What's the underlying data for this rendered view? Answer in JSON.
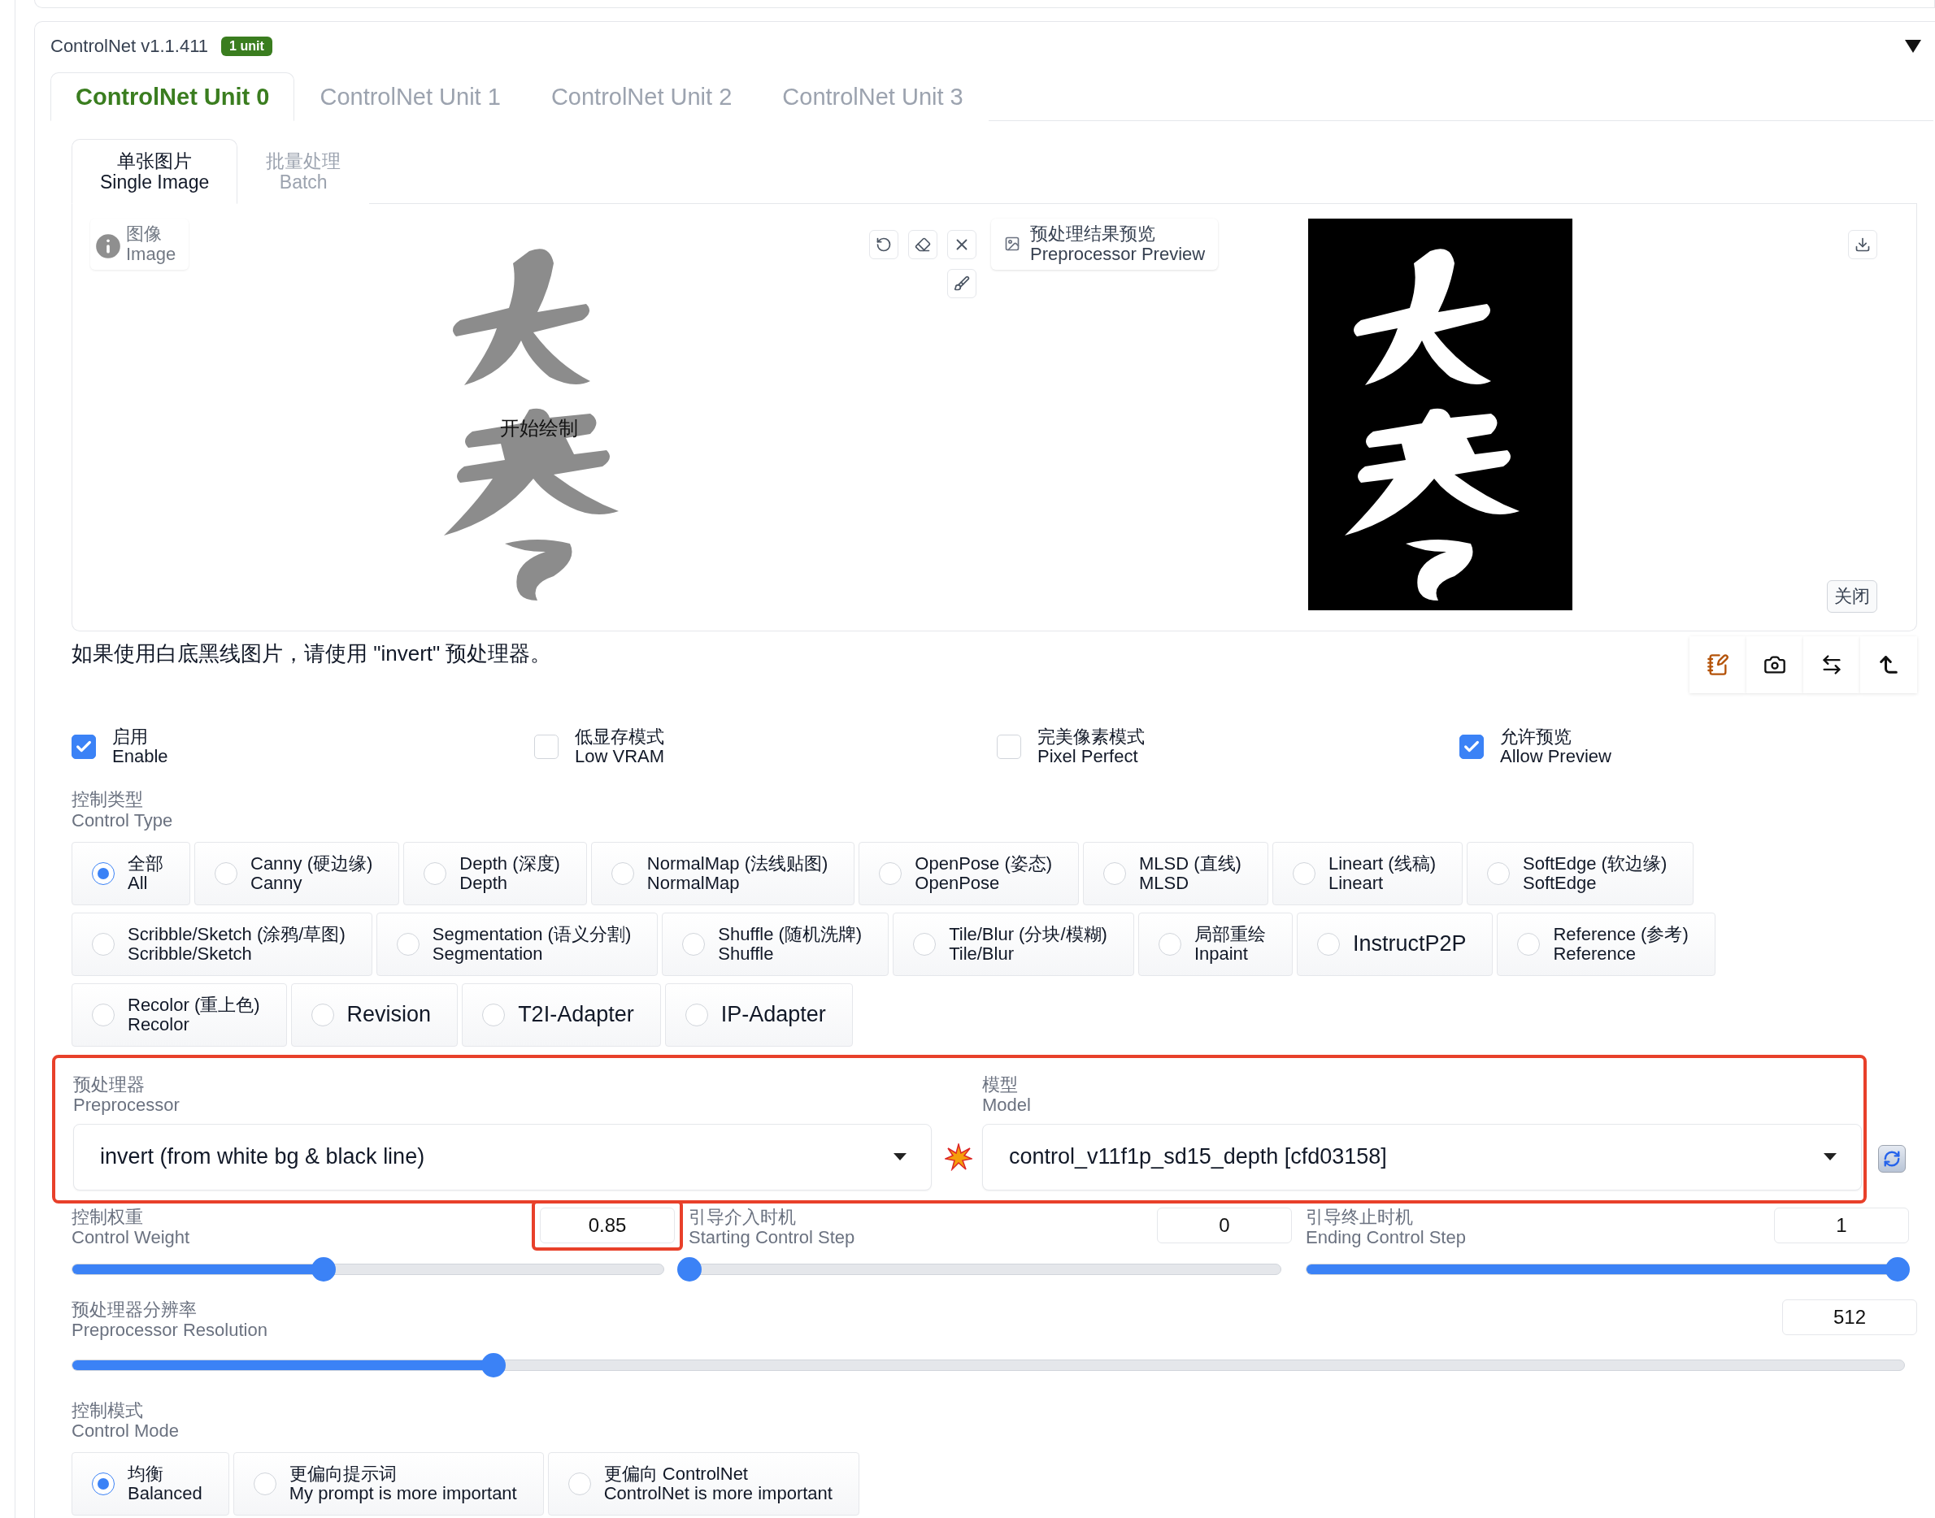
{
  "header": {
    "title": "ControlNet v1.1.411",
    "badge": "1 unit",
    "expanded": true
  },
  "unit_tabs": [
    {
      "label": "ControlNet Unit 0",
      "selected": true
    },
    {
      "label": "ControlNet Unit 1",
      "selected": false
    },
    {
      "label": "ControlNet Unit 2",
      "selected": false
    },
    {
      "label": "ControlNet Unit 3",
      "selected": false
    }
  ],
  "input_tabs": [
    {
      "label": "单张图片",
      "sublabel": "Single Image",
      "selected": true
    },
    {
      "label": "批量处理",
      "sublabel": "Batch",
      "selected": false
    }
  ],
  "image_editor": {
    "label": "图像",
    "sublabel": "Image",
    "hint": "开始绘制"
  },
  "preview": {
    "label": "预处理结果预览",
    "sublabel": "Preprocessor Preview",
    "close_button": "关闭"
  },
  "note": "如果使用白底黑线图片，请使用 \"invert\" 预处理器。",
  "options": [
    {
      "label": "启用",
      "sublabel": "Enable",
      "checked": true
    },
    {
      "label": "低显存模式",
      "sublabel": "Low VRAM",
      "checked": false
    },
    {
      "label": "完美像素模式",
      "sublabel": "Pixel Perfect",
      "checked": false
    },
    {
      "label": "允许预览",
      "sublabel": "Allow Preview",
      "checked": true
    }
  ],
  "control_type": {
    "label": "控制类型",
    "sublabel": "Control Type",
    "options": [
      {
        "label": "全部",
        "sublabel": "All",
        "selected": true
      },
      {
        "label": "Canny (硬边缘)",
        "sublabel": "Canny",
        "selected": false
      },
      {
        "label": "Depth (深度)",
        "sublabel": "Depth",
        "selected": false
      },
      {
        "label": "NormalMap (法线贴图)",
        "sublabel": "NormalMap",
        "selected": false
      },
      {
        "label": "OpenPose (姿态)",
        "sublabel": "OpenPose",
        "selected": false
      },
      {
        "label": "MLSD (直线)",
        "sublabel": "MLSD",
        "selected": false
      },
      {
        "label": "Lineart (线稿)",
        "sublabel": "Lineart",
        "selected": false
      },
      {
        "label": "SoftEdge (软边缘)",
        "sublabel": "SoftEdge",
        "selected": false
      },
      {
        "label": "Scribble/Sketch (涂鸦/草图)",
        "sublabel": "Scribble/Sketch",
        "selected": false
      },
      {
        "label": "Segmentation (语义分割)",
        "sublabel": "Segmentation",
        "selected": false
      },
      {
        "label": "Shuffle (随机洗牌)",
        "sublabel": "Shuffle",
        "selected": false
      },
      {
        "label": "Tile/Blur (分块/模糊)",
        "sublabel": "Tile/Blur",
        "selected": false
      },
      {
        "label": "局部重绘",
        "sublabel": "Inpaint",
        "selected": false
      },
      {
        "label": "InstructP2P",
        "selected": false
      },
      {
        "label": "Reference (参考)",
        "sublabel": "Reference",
        "selected": false
      },
      {
        "label": "Recolor (重上色)",
        "sublabel": "Recolor",
        "selected": false
      },
      {
        "label": "Revision",
        "selected": false
      },
      {
        "label": "T2I-Adapter",
        "selected": false
      },
      {
        "label": "IP-Adapter",
        "selected": false
      }
    ]
  },
  "selectors": {
    "highlighted": true,
    "preprocessor": {
      "label": "预处理器",
      "sublabel": "Preprocessor",
      "value": "invert (from white bg & black line)"
    },
    "model": {
      "label": "模型",
      "sublabel": "Model",
      "value": "control_v11f1p_sd15_depth [cfd03158]"
    }
  },
  "sliders": [
    {
      "label": "控制权重",
      "sublabel": "Control Weight",
      "value": "0.85",
      "level": 0.425,
      "highlighted": true
    },
    {
      "label": "引导介入时机",
      "sublabel": "Starting Control Step",
      "value": "0",
      "level": 0,
      "highlighted": false
    },
    {
      "label": "引导终止时机",
      "sublabel": "Ending Control Step",
      "value": "1",
      "level": 1,
      "highlighted": false
    }
  ],
  "resolution": {
    "label": "预处理器分辨率",
    "sublabel": "Preprocessor Resolution",
    "value": "512",
    "level": 0.23
  },
  "control_mode": {
    "label": "控制模式",
    "sublabel": "Control Mode",
    "options": [
      {
        "label": "均衡",
        "sublabel": "Balanced",
        "selected": true
      },
      {
        "label": "更偏向提示词",
        "sublabel": "My prompt is more important",
        "selected": false
      },
      {
        "label": "更偏向 ControlNet",
        "sublabel": "ControlNet is more important",
        "selected": false
      }
    ]
  }
}
